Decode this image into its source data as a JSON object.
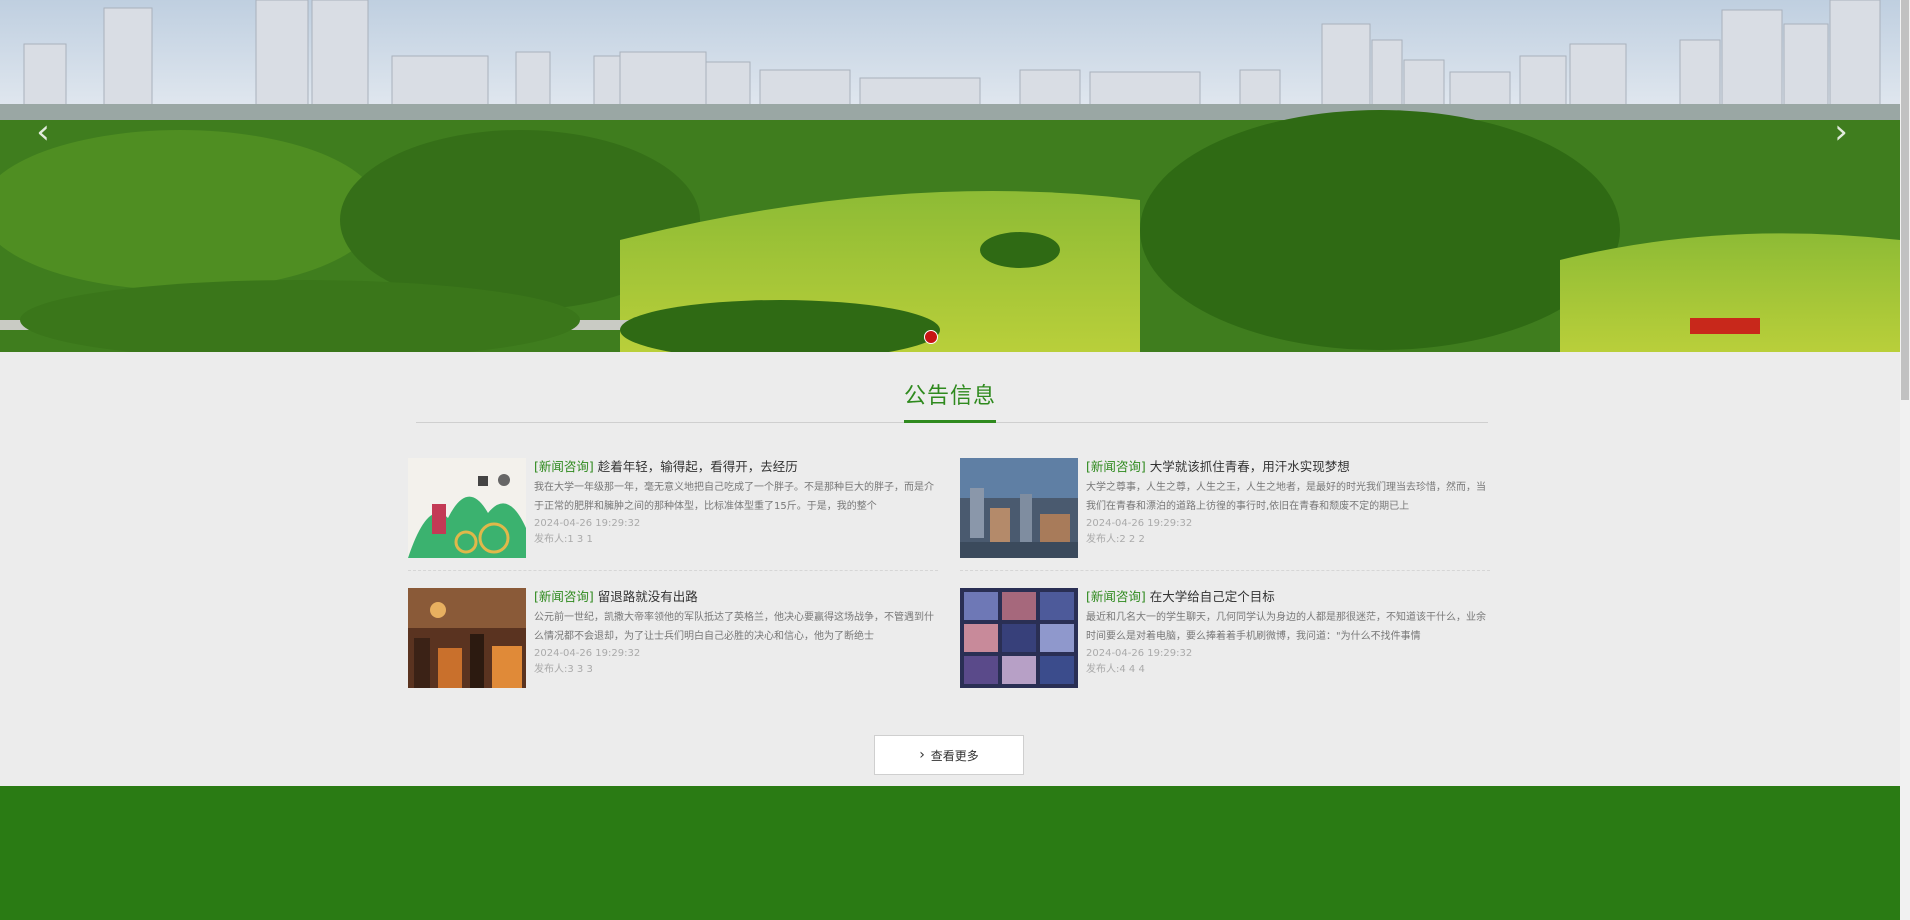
{
  "carousel": {
    "prev_glyph": "‹",
    "next_glyph": "›"
  },
  "section": {
    "title": "公告信息"
  },
  "news": [
    {
      "tag": "[新闻咨询]",
      "title": "趁着年轻，输得起，看得开，去经历",
      "excerpt": "我在大学一年级那一年，毫无意义地把自己吃成了一个胖子。不是那种巨大的胖子，而是介于正常的肥胖和臃肿之间的那种体型，比标准体型重了15斤。于是，我的整个",
      "date": "2024-04-26 19:29:32",
      "stats": "发布人:1 3 1"
    },
    {
      "tag": "[新闻咨询]",
      "title": "大学就该抓住青春，用汗水实现梦想",
      "excerpt": "大学之尊事，人生之尊，人生之王，人生之地者，是最好的时光我们理当去珍惜，然而，当我们在青春和漂泊的道路上彷徨的事行时,依旧在青春和颓废不定的期已上",
      "date": "2024-04-26 19:29:32",
      "stats": "发布人:2 2 2"
    },
    {
      "tag": "[新闻咨询]",
      "title": "留退路就没有出路",
      "excerpt": "公元前一世纪，凯撒大帝率领他的军队抵达了英格兰，他决心要赢得这场战争，不管遇到什么情况都不会退却，为了让士兵们明白自己必胜的决心和信心，他为了断绝士",
      "date": "2024-04-26 19:29:32",
      "stats": "发布人:3 3 3"
    },
    {
      "tag": "[新闻咨询]",
      "title": "在大学给自己定个目标",
      "excerpt": "最近和几名大一的学生聊天，几何同学认为身边的人都是那很迷茫，不知道该干什么，业余时间要么是对着电脑，要么捧着着手机刷微博，我问道：\"为什么不找件事情",
      "date": "2024-04-26 19:29:32",
      "stats": "发布人:4 4 4"
    }
  ],
  "more_button": {
    "label": "查看更多",
    "icon": "chevron-right-icon"
  },
  "colors": {
    "accent": "#2f8a1e",
    "footer": "#2a7b14",
    "active_dot": "#c81414"
  }
}
